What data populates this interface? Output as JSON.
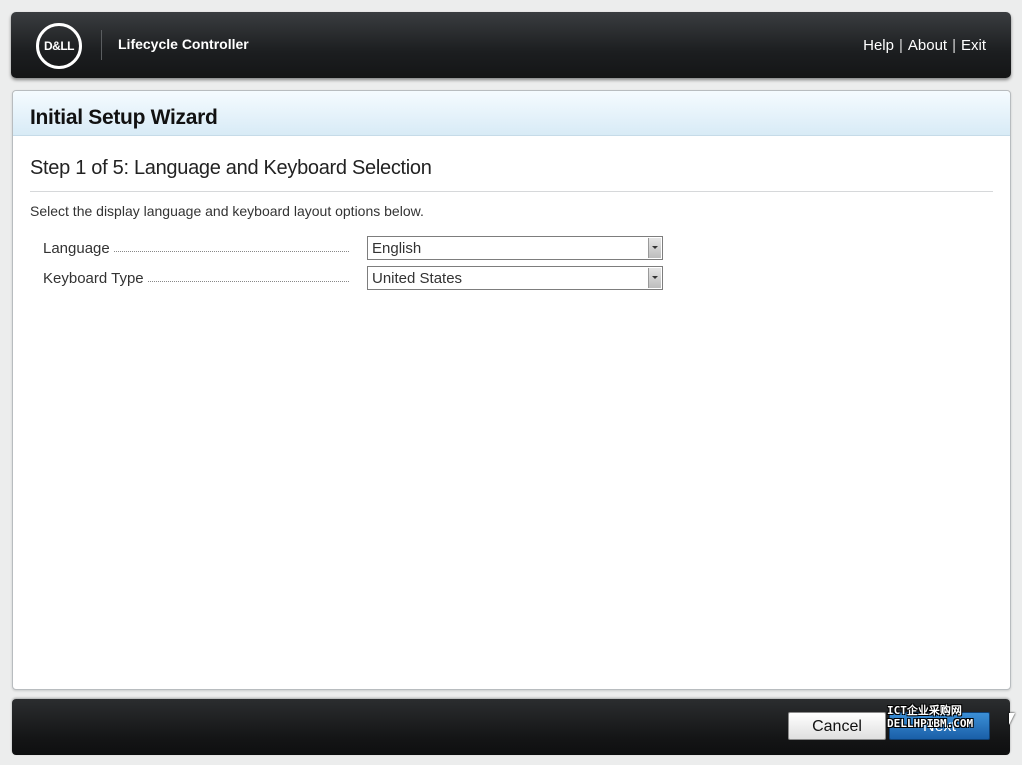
{
  "header": {
    "logo_text": "D&LL",
    "product_name": "Lifecycle Controller",
    "links": [
      "Help",
      "About",
      "Exit"
    ]
  },
  "panel": {
    "title": "Initial Setup Wizard",
    "step_title": "Step 1 of 5: Language and Keyboard Selection",
    "instructions": "Select the display language and keyboard layout options below.",
    "fields": [
      {
        "label": "Language",
        "value": "English"
      },
      {
        "label": "Keyboard Type",
        "value": "United States"
      }
    ]
  },
  "footer": {
    "cancel_label": "Cancel",
    "next_label": "Next"
  },
  "watermark": {
    "line1": "ICT企业采购网",
    "line2": "DELLHPIBM.COM"
  },
  "colors": {
    "header_bg": "#1c1e20",
    "title_bar_bg": "#d8ebf6",
    "primary_button": "#1a5fa8"
  }
}
